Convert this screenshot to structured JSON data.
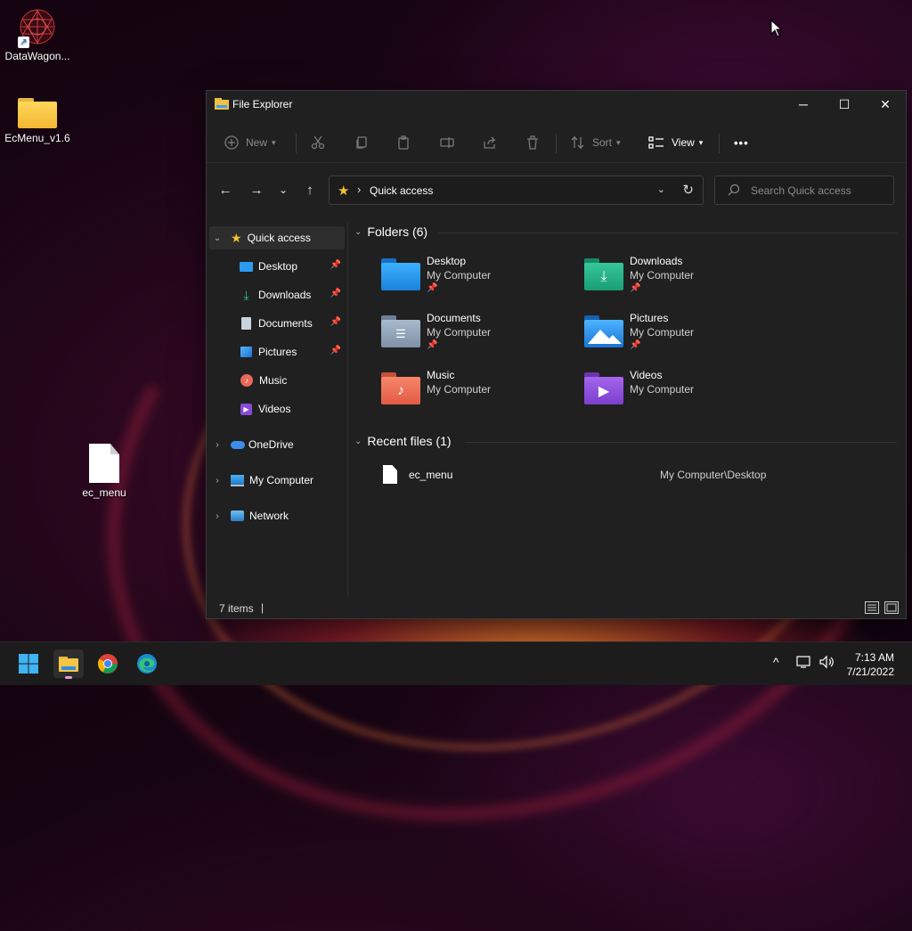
{
  "desktop": {
    "icons": [
      {
        "label": "DataWagon..."
      },
      {
        "label": "EcMenu_v1.6"
      },
      {
        "label": "ec_menu"
      }
    ]
  },
  "window": {
    "title": "File Explorer",
    "controls": {
      "minimize": "─",
      "maximize": "☐",
      "close": "✕"
    }
  },
  "toolbar": {
    "new_label": "New",
    "sort_label": "Sort",
    "view_label": "View",
    "more_label": "•••"
  },
  "nav": {
    "back": "←",
    "forward": "→",
    "recent": "⌄",
    "up": "↑"
  },
  "address": {
    "separator": "›",
    "location": "Quick access",
    "dropdown": "⌄",
    "refresh": "↻"
  },
  "search": {
    "placeholder": "Search Quick access"
  },
  "sidebar": {
    "items": [
      {
        "label": "Quick access",
        "icon": "star-icon"
      },
      {
        "label": "Desktop",
        "icon": "desktop-folder-icon"
      },
      {
        "label": "Downloads",
        "icon": "download-icon"
      },
      {
        "label": "Documents",
        "icon": "documents-icon"
      },
      {
        "label": "Pictures",
        "icon": "pictures-icon"
      },
      {
        "label": "Music",
        "icon": "music-icon"
      },
      {
        "label": "Videos",
        "icon": "videos-icon"
      },
      {
        "label": "OneDrive",
        "icon": "cloud-icon"
      },
      {
        "label": "My Computer",
        "icon": "monitor-icon"
      },
      {
        "label": "Network",
        "icon": "network-icon"
      }
    ]
  },
  "content": {
    "folders_header": "Folders (6)",
    "folders": [
      {
        "name": "Desktop",
        "location": "My Computer",
        "pinned": true,
        "color": "#1e90e6"
      },
      {
        "name": "Downloads",
        "location": "My Computer",
        "pinned": true,
        "color": "#21a67a"
      },
      {
        "name": "Documents",
        "location": "My Computer",
        "pinned": true,
        "color": "#8fa3b8"
      },
      {
        "name": "Pictures",
        "location": "My Computer",
        "pinned": true,
        "color": "#1e88e0"
      },
      {
        "name": "Music",
        "location": "My Computer",
        "pinned": false,
        "color": "#e86a4e"
      },
      {
        "name": "Videos",
        "location": "My Computer",
        "pinned": false,
        "color": "#8a4bd6"
      }
    ],
    "recent_header": "Recent files (1)",
    "recent": [
      {
        "name": "ec_menu",
        "path": "My Computer\\Desktop"
      }
    ]
  },
  "status": {
    "items": "7 items",
    "divider": "|"
  },
  "taskbar": {
    "time": "7:13 AM",
    "date": "7/21/2022",
    "tray_chevron": "^"
  }
}
